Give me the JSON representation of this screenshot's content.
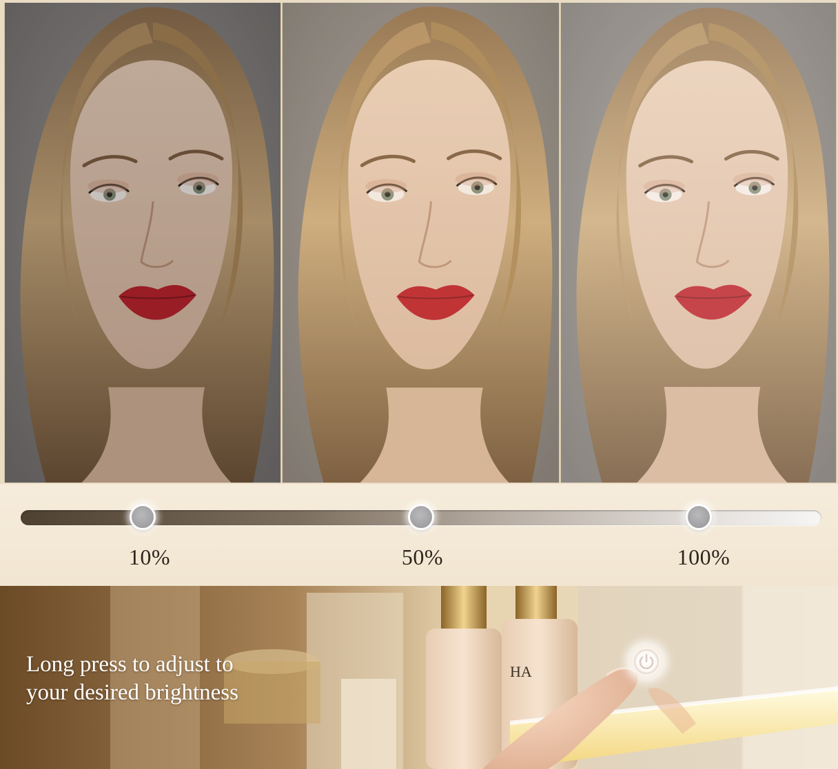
{
  "brightness_levels": [
    {
      "label": "10%",
      "value": 10
    },
    {
      "label": "50%",
      "value": 50
    },
    {
      "label": "100%",
      "value": 100
    }
  ],
  "caption": {
    "line1": "Long press to adjust to",
    "line2": "your desired brightness"
  },
  "bottle_lettering": "HA",
  "colors": {
    "band_background": "#f4ead8",
    "track_dark": "#4e4130",
    "track_light": "#f7f6f5",
    "knob": "#a4a4a7",
    "label_text": "#2e261d",
    "light_bar": "#fff3b8",
    "lips": "#b81a22"
  },
  "icons": {
    "touch_button": "power-icon"
  }
}
